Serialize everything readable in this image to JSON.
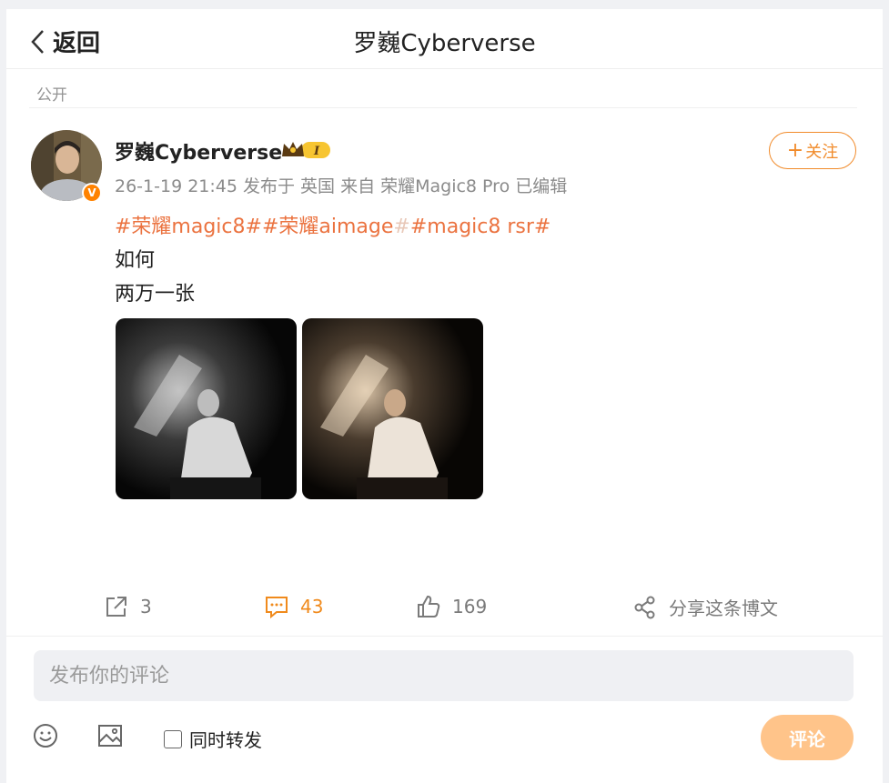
{
  "header": {
    "back_label": "返回",
    "title": "罗巍Cyberverse"
  },
  "visibility": "公开",
  "author": {
    "name": "罗巍Cyberverse",
    "verified_badge": "V",
    "vip_badge": "I",
    "meta": "26-1-19 21:45  发布于 英国  来自 荣耀Magic8 Pro  已编辑"
  },
  "follow_label": "关注",
  "post": {
    "tag1": "#荣耀magic8#",
    "tag2": "#荣耀aimage",
    "tag2_tail": "#",
    "tag3": "#magic8 rsr#",
    "line1": "如何",
    "line2": "两万一张"
  },
  "actions": {
    "repost_count": "3",
    "comment_count": "43",
    "like_count": "169",
    "share_label": "分享这条博文"
  },
  "comment_box": {
    "placeholder": "发布你的评论",
    "also_repost_label": "同时转发",
    "submit_label": "评论"
  },
  "colors": {
    "accent_orange": "#f18b2b",
    "tag_color": "#eb7340",
    "comment_count_color": "#f08a1c",
    "submit_disabled": "#ffc48a"
  }
}
